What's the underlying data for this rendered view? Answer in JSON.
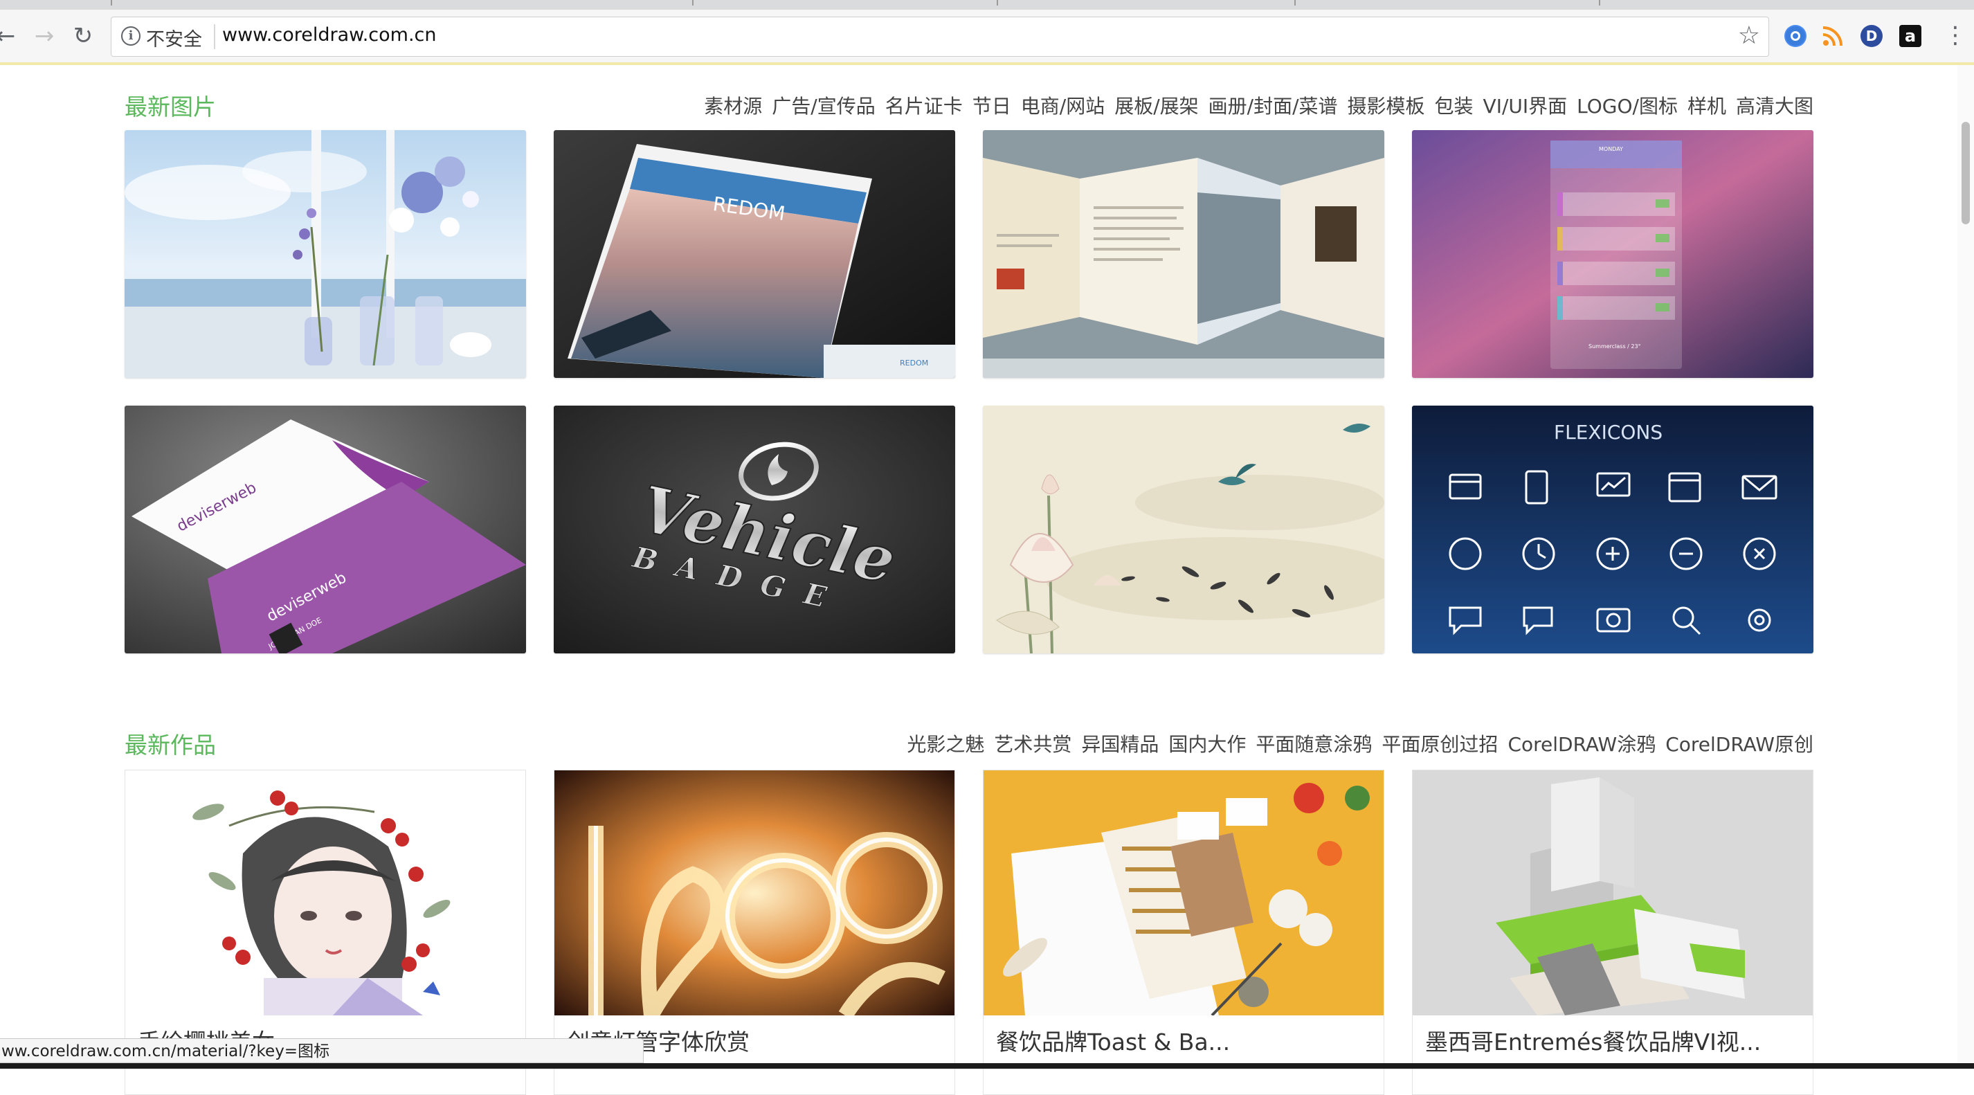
{
  "browser": {
    "security_label": "不安全",
    "url": "www.coreldraw.com.cn",
    "status_url": "ww.coreldraw.com.cn/material/?key=图标",
    "extensions": [
      "chrome-extension-icon",
      "rss-icon",
      "d-extension-icon",
      "amazon-icon"
    ],
    "amazon_letter": "a",
    "d_letter": "D"
  },
  "latest_images": {
    "title": "最新图片",
    "links": [
      "素材源",
      "广告/宣传品",
      "名片证卡",
      "节日",
      "电商/网站",
      "展板/展架",
      "画册/封面/菜谱",
      "摄影模板",
      "包装",
      "VI/UI界面",
      "LOGO/图标",
      "样机",
      "高清大图"
    ],
    "thumbs": [
      {
        "name": "flowers-by-window"
      },
      {
        "name": "redom-brochure",
        "text": "REDOM",
        "small_text": "REDOM"
      },
      {
        "name": "trifold-brochure"
      },
      {
        "name": "calendar-ui",
        "header": "MONDAY",
        "footer": "Summerclass / 23°"
      },
      {
        "name": "deviserweb-business-card",
        "brand": "deviserweb",
        "person": "JONATHAN DOE"
      },
      {
        "name": "vehicle-badge",
        "word1": "Vehicle",
        "word2": "BADGE"
      },
      {
        "name": "lotus-painting"
      },
      {
        "name": "flexicons",
        "title": "FLEXICONS"
      }
    ]
  },
  "latest_works": {
    "title": "最新作品",
    "links": [
      "光影之魅",
      "艺术共赏",
      "异国精品",
      "国内大作",
      "平面随意涂鸦",
      "平面原创过招",
      "CorelDRAW涂鸦",
      "CorelDRAW原创"
    ],
    "cards": [
      {
        "caption": "手绘樱桃美女"
      },
      {
        "caption": "创意灯管字体欣赏"
      },
      {
        "caption": "餐饮品牌Toast & Ba..."
      },
      {
        "caption": "墨西哥Entremés餐饮品牌VI视..."
      }
    ]
  }
}
